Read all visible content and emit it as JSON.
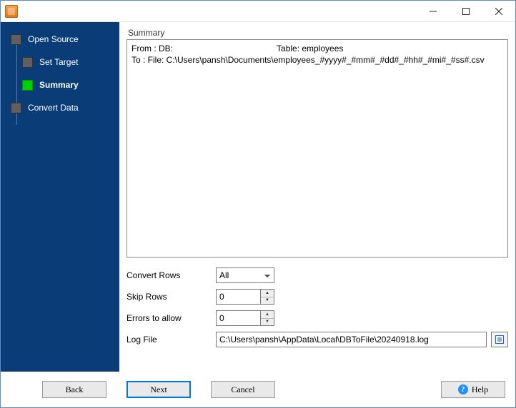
{
  "window": {
    "title": ""
  },
  "sidebar": {
    "steps": [
      {
        "label": "Open Source",
        "active": false
      },
      {
        "label": "Set Target",
        "active": false
      },
      {
        "label": "Summary",
        "active": true
      },
      {
        "label": "Convert Data",
        "active": false
      }
    ]
  },
  "summary": {
    "header": "Summary",
    "line1_from": "From : DB:",
    "line1_table": "Table: employees",
    "line2": "To : File: C:\\Users\\pansh\\Documents\\employees_#yyyy#_#mm#_#dd#_#hh#_#mi#_#ss#.csv"
  },
  "form": {
    "convert_rows_label": "Convert Rows",
    "convert_rows_value": "All",
    "skip_rows_label": "Skip Rows",
    "skip_rows_value": "0",
    "errors_label": "Errors to allow",
    "errors_value": "0",
    "log_label": "Log File",
    "log_value": "C:\\Users\\pansh\\AppData\\Local\\DBToFile\\20240918.log"
  },
  "footer": {
    "back": "Back",
    "next": "Next",
    "cancel": "Cancel",
    "help": "Help"
  }
}
